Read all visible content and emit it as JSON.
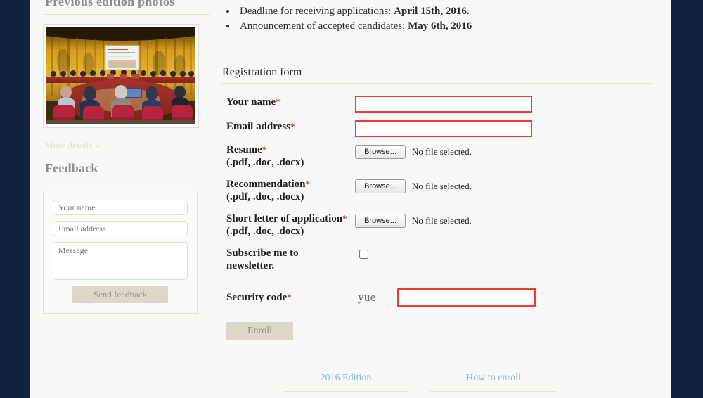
{
  "theme": {
    "page_bg": "#f8f8f7",
    "frame_bg": "#12233f",
    "accent_red": "#ef3b34",
    "button_beige": "#ddd8c9",
    "link_blue": "#8ab4dc",
    "muted_gray": "#8c8c8c"
  },
  "sidebar": {
    "photos": {
      "heading": "Previous edition photos",
      "image_alt": "conference-hall-photo",
      "more_link": "More details »"
    },
    "feedback": {
      "heading": "Feedback",
      "name_placeholder": "Your name",
      "name_value": "",
      "email_placeholder": "Email address",
      "email_value": "",
      "message_placeholder": "Message",
      "message_value": "",
      "submit_label": "Send feedback"
    }
  },
  "main": {
    "deadlines": [
      {
        "text": "Deadline for receiving applications: ",
        "bold": "April 15th, 2016."
      },
      {
        "text": "Announcement of accepted candidates: ",
        "bold": "May 6th, 2016"
      }
    ],
    "form": {
      "title": "Registration form",
      "required_mark": "*",
      "fields": {
        "name": {
          "label": "Your name",
          "value": ""
        },
        "email": {
          "label": "Email address",
          "value": ""
        },
        "resume": {
          "label": "Resume",
          "hint": "(.pdf, .doc, .docx)",
          "browse_label": "Browse...",
          "status": "No file selected."
        },
        "recommendation": {
          "label": "Recommendation",
          "hint": "(.pdf, .doc, .docx)",
          "browse_label": "Browse...",
          "status": "No file selected."
        },
        "letter": {
          "label": "Short letter of application",
          "hint": "(.pdf, .doc, .docx)",
          "browse_label": "Browse...",
          "status": "No file selected."
        },
        "subscribe": {
          "label_line1": "Subscribe me to",
          "label_line2": "newsletter.",
          "checked": false
        },
        "security": {
          "label": "Security code",
          "captcha": "yue",
          "value": ""
        }
      },
      "submit_label": "Enroll"
    }
  },
  "footer": {
    "links": [
      {
        "label": "2016 Edition"
      },
      {
        "label": "How to enroll"
      }
    ]
  }
}
